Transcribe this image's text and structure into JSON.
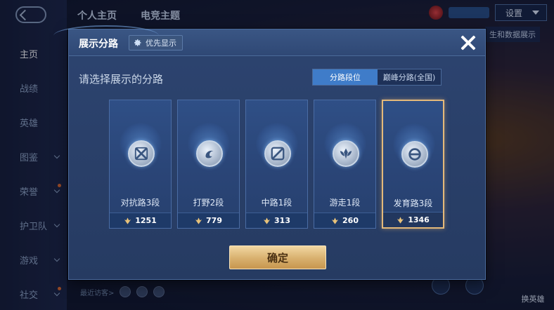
{
  "background": {
    "top_tabs": [
      "个人主页",
      "电竞主题"
    ],
    "side_nav": [
      {
        "label": "主页",
        "active": true,
        "chevron": false,
        "dot": false
      },
      {
        "label": "战绩",
        "active": false,
        "chevron": false,
        "dot": false
      },
      {
        "label": "英雄",
        "active": false,
        "chevron": false,
        "dot": false
      },
      {
        "label": "图鉴",
        "active": false,
        "chevron": true,
        "dot": false
      },
      {
        "label": "荣誉",
        "active": false,
        "chevron": true,
        "dot": true
      },
      {
        "label": "护卫队",
        "active": false,
        "chevron": true,
        "dot": false
      },
      {
        "label": "游戏",
        "active": false,
        "chevron": true,
        "dot": false
      },
      {
        "label": "社交",
        "active": false,
        "chevron": true,
        "dot": true
      }
    ],
    "settings_label": "设置",
    "data_display_label": "生和数据展示",
    "recent_visitors_label": "最近访客>",
    "hero_switch_label": "换英雄"
  },
  "dialog": {
    "title": "展示分路",
    "priority_label": "优先显示",
    "prompt": "请选择展示的分路",
    "toggle": [
      "分路段位",
      "巅峰分路(全国)"
    ],
    "toggle_active": 0,
    "lanes": [
      {
        "label": "对抗路3段",
        "score": "1251",
        "icon": "crossed-swords-icon",
        "selected": false
      },
      {
        "label": "打野2段",
        "score": "779",
        "icon": "jungle-swirl-icon",
        "selected": false
      },
      {
        "label": "中路1段",
        "score": "313",
        "icon": "mid-lane-icon",
        "selected": false
      },
      {
        "label": "游走1段",
        "score": "260",
        "icon": "roam-wings-icon",
        "selected": false
      },
      {
        "label": "发育路3段",
        "score": "1346",
        "icon": "farm-lane-icon",
        "selected": true
      }
    ],
    "confirm_label": "确定"
  },
  "colors": {
    "dialog_bg": "#2a4170",
    "toggle_active": "#3f7cc9",
    "selected_border": "#e4b97a",
    "confirm_gold": "#d8b06e"
  }
}
